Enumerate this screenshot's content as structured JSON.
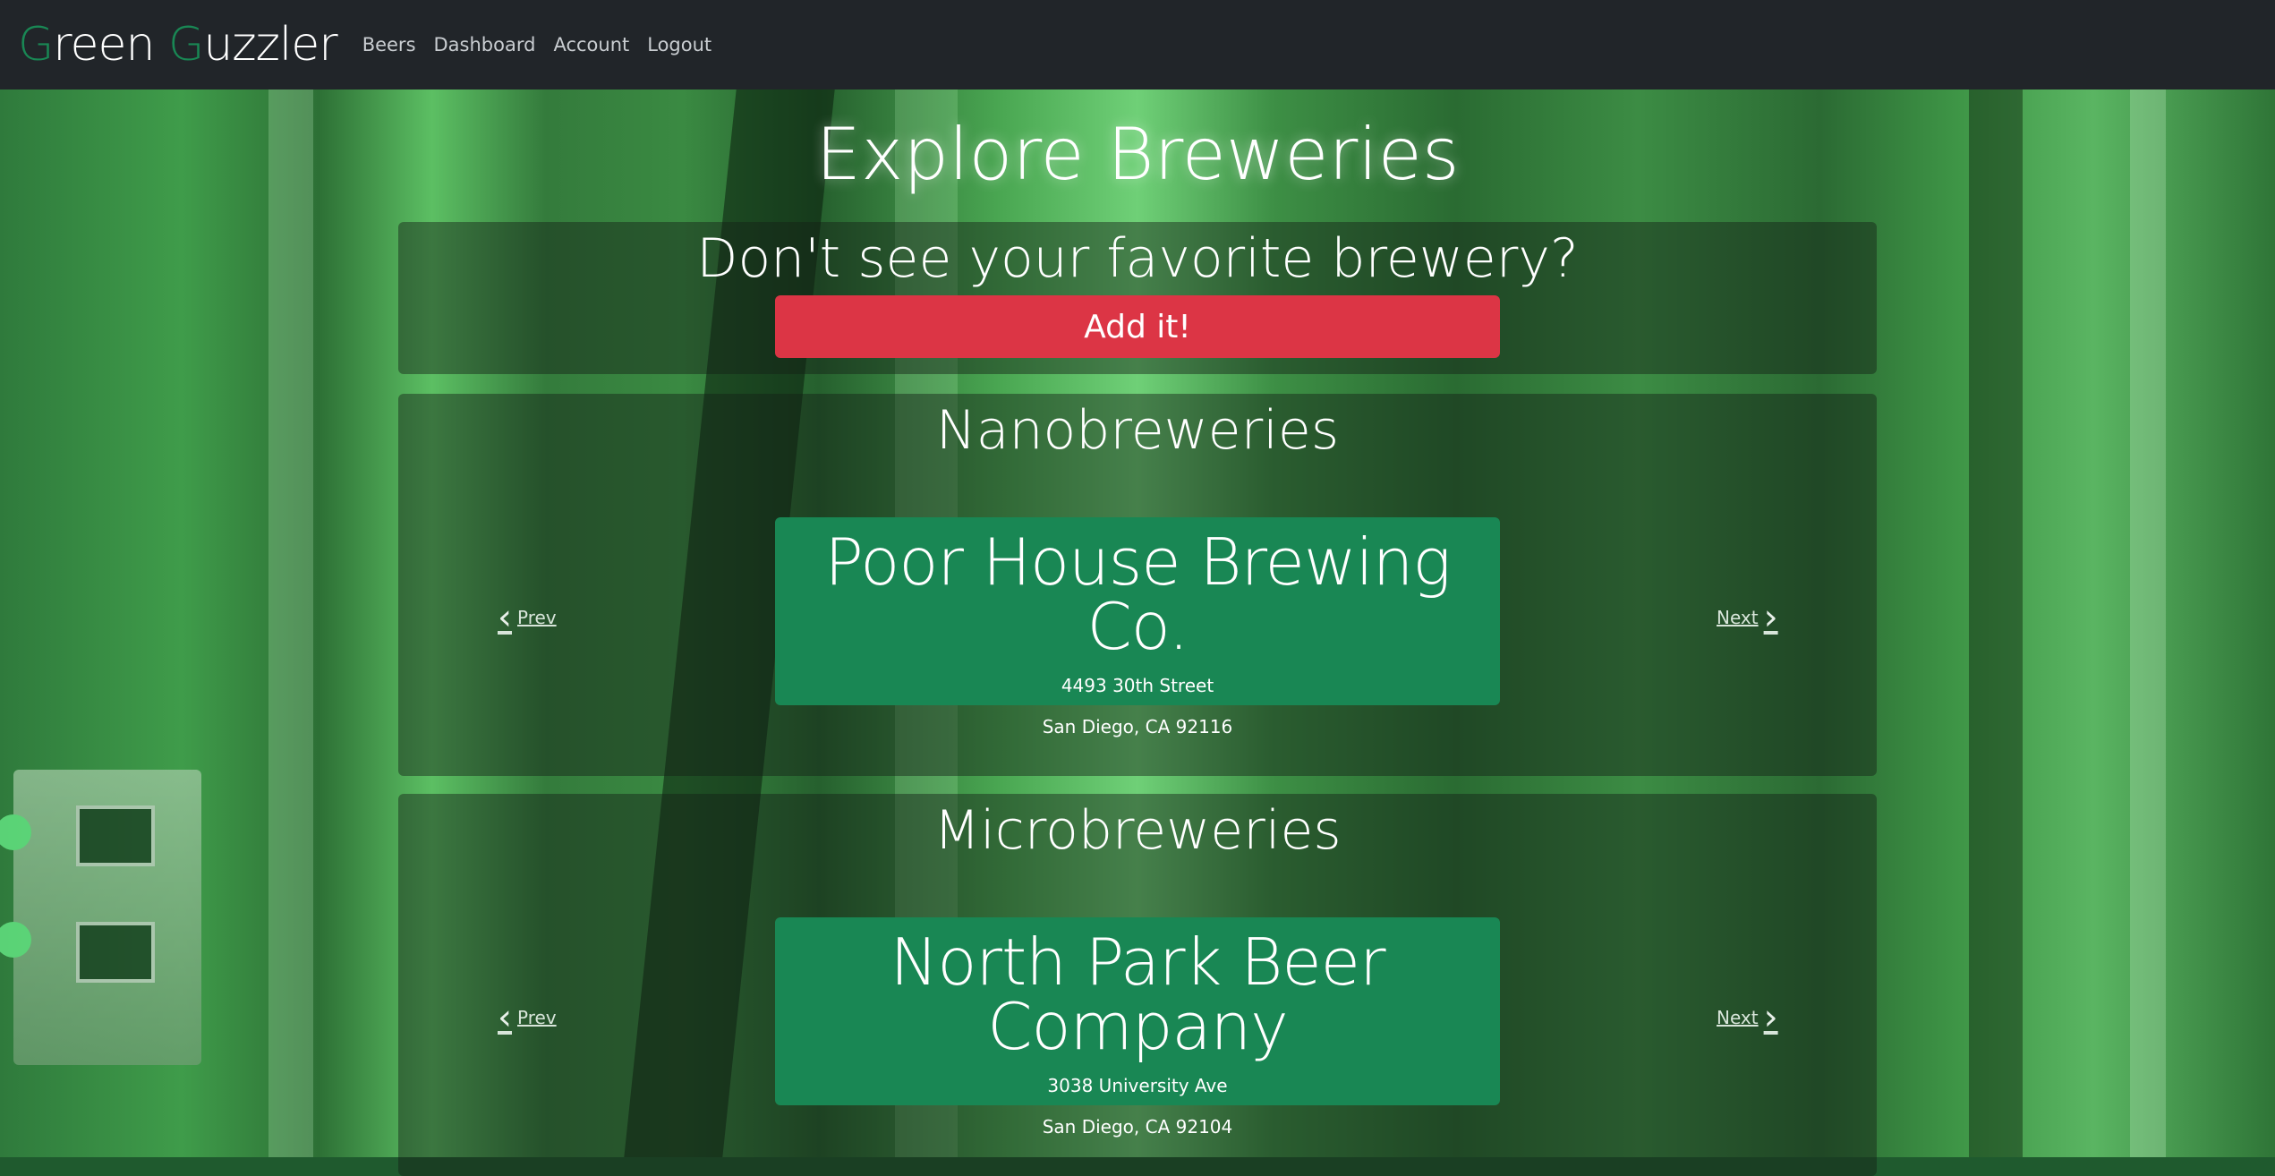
{
  "brand": {
    "first_letter": "G",
    "first_rest": "reen",
    "second_letter": "G",
    "second_rest": "uzzler",
    "accent": "#198754"
  },
  "nav": {
    "items": [
      {
        "label": "Beers"
      },
      {
        "label": "Dashboard"
      },
      {
        "label": "Account"
      },
      {
        "label": "Logout"
      }
    ]
  },
  "page": {
    "title": "Explore Breweries"
  },
  "cta": {
    "text": "Don't see your favorite brewery?",
    "button": "Add it!",
    "button_color": "#dc3545"
  },
  "sections": [
    {
      "title": "Nanobreweries",
      "prev": "Prev",
      "next": "Next",
      "brewery": {
        "name": "Poor House Brewing Co.",
        "street": "4493 30th Street",
        "city": "San Diego, CA 92116"
      }
    },
    {
      "title": "Microbreweries",
      "prev": "Prev",
      "next": "Next",
      "brewery": {
        "name": "North Park Beer Company",
        "street": "3038 University Ave",
        "city": "San Diego, CA 92104"
      }
    }
  ],
  "icons": {
    "prev": "chevron-left-icon",
    "next": "chevron-right-icon"
  }
}
